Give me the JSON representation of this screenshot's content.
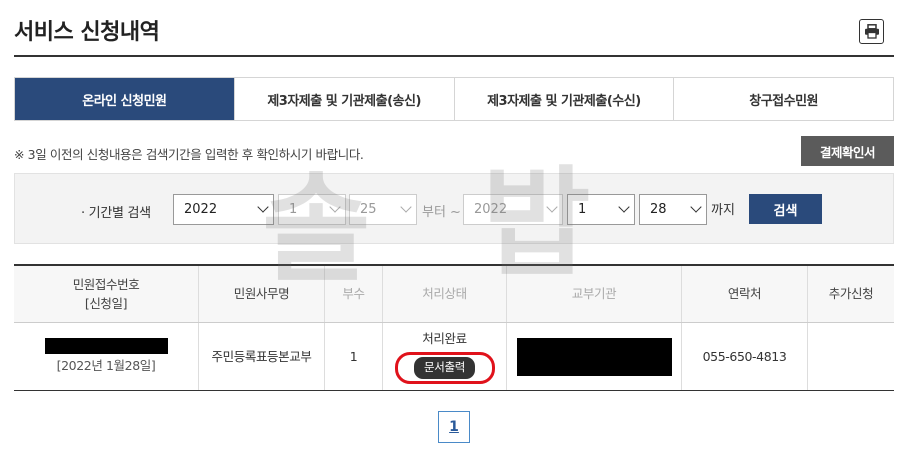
{
  "page": {
    "title": "서비스 신청내역"
  },
  "tabs": [
    {
      "label": "온라인 신청민원",
      "active": true
    },
    {
      "label": "제3자제출 및 기관제출(송신)",
      "active": false
    },
    {
      "label": "제3자제출 및 기관제출(수신)",
      "active": false
    },
    {
      "label": "창구접수민원",
      "active": false
    }
  ],
  "notice": "※ 3일 이전의 신청내용은 검색기간을 입력한 후 확인하시기 바랍니다.",
  "receipt_button": "결제확인서",
  "search": {
    "label": "· 기간별 검색",
    "from": {
      "year": "2022",
      "month": "1",
      "day": "25"
    },
    "from_suffix": "부터 ~",
    "to": {
      "year": "2022",
      "month": "1",
      "day": "28"
    },
    "to_suffix": "까지",
    "button": "검색"
  },
  "table": {
    "headers": [
      "민원접수번호",
      "[신청일]",
      "민원사무명",
      "부수",
      "처리상태",
      "교부기관",
      "연락처",
      "추가신청"
    ],
    "row": {
      "date": "[2022년 1월28일]",
      "service": "주민등록표등본교부",
      "copies": "1",
      "status": "처리완료",
      "print_button": "문서출력",
      "phone": "055-650-4813",
      "extra": ""
    }
  },
  "pagination": {
    "current": "1"
  },
  "watermark": {
    "left": "솔",
    "right": "밥"
  },
  "colors": {
    "primary": "#2a4a7b",
    "highlight": "#e0121b",
    "receipt_button": "#5b5b5b"
  }
}
